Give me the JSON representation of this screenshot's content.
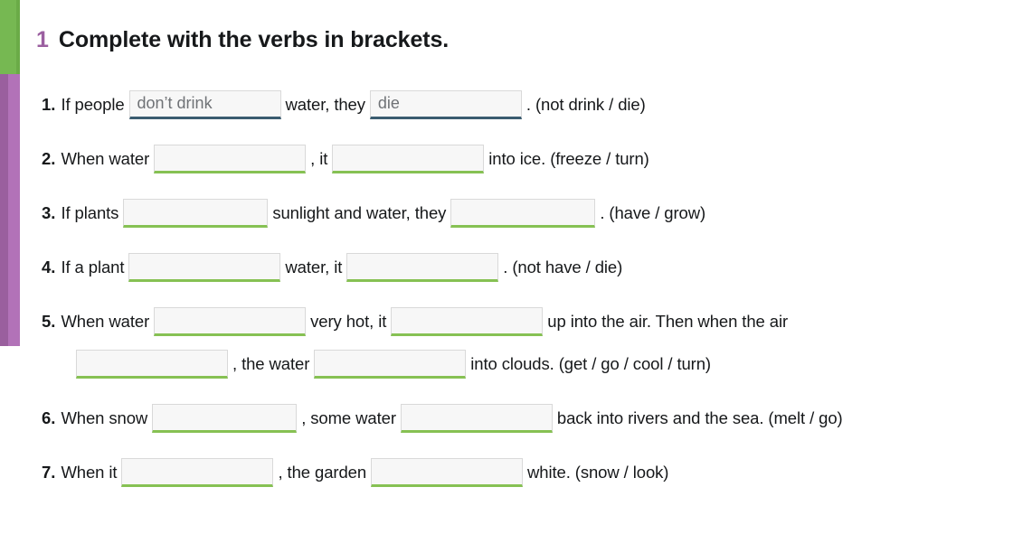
{
  "decor": {
    "green_bar_color": "#76b852",
    "purple_bar_color": "#b272b8"
  },
  "heading": {
    "number": "1",
    "title": "Complete with the verbs in brackets.",
    "number_color": "#9b5fa0"
  },
  "exercise": {
    "items": [
      {
        "number": "1.",
        "lines": [
          {
            "parts": [
              {
                "kind": "text",
                "value": "If people"
              },
              {
                "kind": "blank",
                "value": "don’t drink",
                "state": "filled",
                "width": "w-lg"
              },
              {
                "kind": "text",
                "value": "water, they"
              },
              {
                "kind": "blank",
                "value": "die",
                "state": "filled",
                "width": "w-lg"
              },
              {
                "kind": "text",
                "value": ". (not drink / die)"
              }
            ]
          }
        ]
      },
      {
        "number": "2.",
        "lines": [
          {
            "parts": [
              {
                "kind": "text",
                "value": "When water"
              },
              {
                "kind": "blank",
                "value": "",
                "state": "empty",
                "width": "w-lg"
              },
              {
                "kind": "text",
                "value": ", it"
              },
              {
                "kind": "blank",
                "value": "",
                "state": "empty",
                "width": "w-lg"
              },
              {
                "kind": "text",
                "value": "into ice. (freeze / turn)"
              }
            ]
          }
        ]
      },
      {
        "number": "3.",
        "lines": [
          {
            "parts": [
              {
                "kind": "text",
                "value": "If plants"
              },
              {
                "kind": "blank",
                "value": "",
                "state": "empty",
                "width": "w-md"
              },
              {
                "kind": "text",
                "value": "sunlight and water, they"
              },
              {
                "kind": "blank",
                "value": "",
                "state": "empty",
                "width": "w-md"
              },
              {
                "kind": "text",
                "value": ". (have / grow)"
              }
            ]
          }
        ]
      },
      {
        "number": "4.",
        "lines": [
          {
            "parts": [
              {
                "kind": "text",
                "value": "If a plant"
              },
              {
                "kind": "blank",
                "value": "",
                "state": "empty",
                "width": "w-lg"
              },
              {
                "kind": "text",
                "value": "water, it"
              },
              {
                "kind": "blank",
                "value": "",
                "state": "empty",
                "width": "w-lg"
              },
              {
                "kind": "text",
                "value": ". (not have / die)"
              }
            ]
          }
        ]
      },
      {
        "number": "5.",
        "lines": [
          {
            "parts": [
              {
                "kind": "text",
                "value": "When water"
              },
              {
                "kind": "blank",
                "value": "",
                "state": "empty",
                "width": "w-lg"
              },
              {
                "kind": "text",
                "value": "very hot, it"
              },
              {
                "kind": "blank",
                "value": "",
                "state": "empty",
                "width": "w-lg"
              },
              {
                "kind": "text",
                "value": "up into the air. Then when the air"
              }
            ]
          },
          {
            "indent": true,
            "parts": [
              {
                "kind": "blank",
                "value": "",
                "state": "empty",
                "width": "w-lg"
              },
              {
                "kind": "text",
                "value": ", the water"
              },
              {
                "kind": "blank",
                "value": "",
                "state": "empty",
                "width": "w-lg"
              },
              {
                "kind": "text",
                "value": "into clouds. (get / go / cool / turn)"
              }
            ]
          }
        ]
      },
      {
        "number": "6.",
        "lines": [
          {
            "parts": [
              {
                "kind": "text",
                "value": "When snow"
              },
              {
                "kind": "blank",
                "value": "",
                "state": "empty",
                "width": "w-md"
              },
              {
                "kind": "text",
                "value": ", some water"
              },
              {
                "kind": "blank",
                "value": "",
                "state": "empty",
                "width": "w-lg"
              },
              {
                "kind": "text",
                "value": "back into rivers and the sea. (melt / go)"
              }
            ]
          }
        ]
      },
      {
        "number": "7.",
        "lines": [
          {
            "parts": [
              {
                "kind": "text",
                "value": "When it"
              },
              {
                "kind": "blank",
                "value": "",
                "state": "empty",
                "width": "w-lg"
              },
              {
                "kind": "text",
                "value": ", the garden"
              },
              {
                "kind": "blank",
                "value": "",
                "state": "empty",
                "width": "w-lg"
              },
              {
                "kind": "text",
                "value": "white. (snow / look)"
              }
            ]
          }
        ]
      }
    ]
  }
}
